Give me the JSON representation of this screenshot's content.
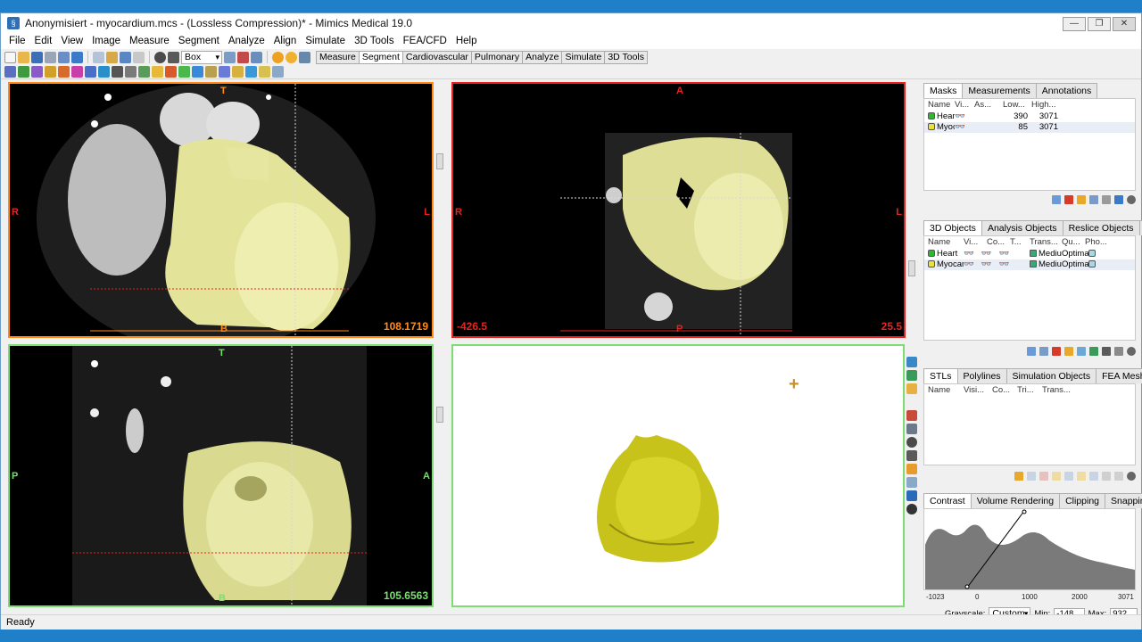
{
  "window": {
    "title": "Anonymisiert - myocardium.mcs -  (Lossless Compression)* - Mimics Medical 19.0",
    "controls": [
      "—",
      "❐",
      "✕"
    ]
  },
  "menu": [
    "File",
    "Edit",
    "View",
    "Image",
    "Measure",
    "Segment",
    "Analyze",
    "Align",
    "Simulate",
    "3D Tools",
    "FEA/CFD",
    "Help"
  ],
  "toolbar": {
    "select_value": "Box",
    "tabs": [
      "Measure",
      "Segment",
      "Cardiovascular",
      "Pulmonary",
      "Analyze",
      "Simulate",
      "3D Tools"
    ],
    "active_tab": "Segment"
  },
  "viewports": {
    "axial": {
      "top": "T",
      "left": "R",
      "right": "L",
      "bottom": "B",
      "value": "108.1719",
      "accent": "#ff8c1a"
    },
    "coronal": {
      "top": "A",
      "left": "R",
      "right": "L",
      "bottom": "P",
      "value_left": "-426.5",
      "value_right": "25.5",
      "accent": "#e8231f"
    },
    "sagittal": {
      "top": "T",
      "left": "P",
      "right": "A",
      "bottom": "B",
      "value": "105.6563",
      "accent": "#7ddc72"
    },
    "render3d": {
      "accent": "#7ddc72"
    }
  },
  "masks_panel": {
    "tabs": [
      "Masks",
      "Measurements",
      "Annotations"
    ],
    "columns": [
      "Name",
      "Vi...",
      "As...",
      "Low...",
      "High..."
    ],
    "rows": [
      {
        "name": "Heart",
        "low": "390",
        "high": "3071",
        "color": "#2fb82f"
      },
      {
        "name": "Myocz",
        "low": "85",
        "high": "3071",
        "color": "#e8e23a"
      }
    ]
  },
  "objects_panel": {
    "tabs": [
      "3D Objects",
      "Analysis Objects",
      "Reslice Objects",
      "Sc"
    ],
    "columns": [
      "Name",
      "Vi...",
      "Co...",
      "T...",
      "Trans...",
      "Qu...",
      "Pho..."
    ],
    "rows": [
      {
        "name": "Heart",
        "trans": "Mediur",
        "quality": "Optima",
        "color": "#2fb82f"
      },
      {
        "name": "Myocar",
        "trans": "Mediur",
        "quality": "Optima",
        "color": "#e8e23a"
      }
    ]
  },
  "stl_panel": {
    "tabs": [
      "STLs",
      "Polylines",
      "Simulation Objects",
      "FEA Mesh"
    ],
    "columns": [
      "Name",
      "Visi...",
      "Co...",
      "Tri...",
      "Trans..."
    ]
  },
  "contrast_panel": {
    "tabs": [
      "Contrast",
      "Volume Rendering",
      "Clipping",
      "Snapping"
    ],
    "axis_ticks": [
      "-1023",
      "0",
      "1000",
      "2000",
      "3071"
    ],
    "grayscale_label": "Grayscale:",
    "grayscale_value": "Custom s",
    "min_label": "Min:",
    "min_value": "-148",
    "max_label": "Max:",
    "max_value": "932"
  },
  "status": "Ready"
}
